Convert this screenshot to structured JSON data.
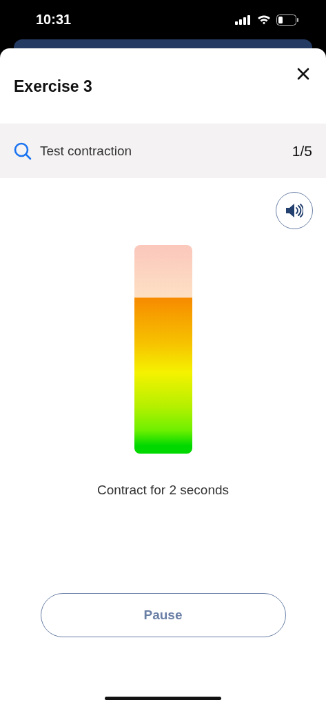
{
  "status_bar": {
    "time": "10:31"
  },
  "header": {
    "title": "Exercise 3"
  },
  "step": {
    "label": "Test contraction",
    "counter": "1/5"
  },
  "meter": {
    "level": 0.75
  },
  "instruction": "Contract for 2 seconds",
  "buttons": [
    "Pause"
  ]
}
